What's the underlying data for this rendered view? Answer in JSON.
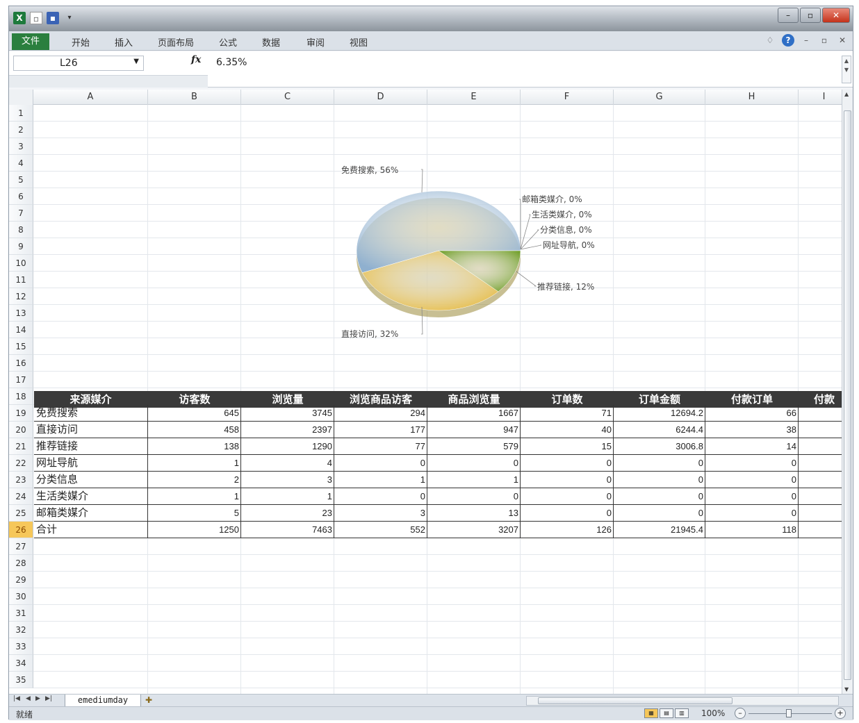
{
  "ribbon": {
    "file_tab": "文件",
    "tabs": [
      "开始",
      "插入",
      "页面布局",
      "公式",
      "数据",
      "审阅",
      "视图"
    ]
  },
  "formula_bar": {
    "name_box": "L26",
    "formula": "6.35%"
  },
  "columns": [
    "A",
    "B",
    "C",
    "D",
    "E",
    "F",
    "G",
    "H",
    "I"
  ],
  "rows": [
    "1",
    "2",
    "3",
    "4",
    "5",
    "6",
    "7",
    "8",
    "9",
    "10",
    "11",
    "12",
    "13",
    "14",
    "15",
    "16",
    "17",
    "18",
    "19",
    "20",
    "21",
    "22",
    "23",
    "24",
    "25",
    "26",
    "27",
    "28",
    "29",
    "30",
    "31",
    "32",
    "33",
    "34",
    "35"
  ],
  "selected_row": "26",
  "chart_data": {
    "type": "pie",
    "title": "",
    "slices": [
      {
        "label": "免费搜索",
        "value": 56,
        "display": "免费搜索, 56%",
        "color": "#8fb0cf"
      },
      {
        "label": "直接访问",
        "value": 32,
        "display": "直接访问, 32%",
        "color": "#e6b93c"
      },
      {
        "label": "推荐链接",
        "value": 12,
        "display": "推荐链接, 12%",
        "color": "#6f9e28"
      },
      {
        "label": "网址导航",
        "value": 0,
        "display": "网址导航, 0%",
        "color": "#8a6bb0"
      },
      {
        "label": "分类信息",
        "value": 0,
        "display": "分类信息, 0%",
        "color": "#4aa5b8"
      },
      {
        "label": "生活类媒介",
        "value": 0,
        "display": "生活类媒介, 0%",
        "color": "#e08a3a"
      },
      {
        "label": "邮箱类媒介",
        "value": 0,
        "display": "邮箱类媒介, 0%",
        "color": "#b04040"
      }
    ]
  },
  "table": {
    "headers": [
      "来源媒介",
      "访客数",
      "浏览量",
      "浏览商品访客",
      "商品浏览量",
      "订单数",
      "订单金额",
      "付款订单",
      "付款"
    ],
    "rows": [
      [
        "免费搜索",
        "645",
        "3745",
        "294",
        "1667",
        "71",
        "12694.2",
        "66",
        ""
      ],
      [
        "直接访问",
        "458",
        "2397",
        "177",
        "947",
        "40",
        "6244.4",
        "38",
        ""
      ],
      [
        "推荐链接",
        "138",
        "1290",
        "77",
        "579",
        "15",
        "3006.8",
        "14",
        ""
      ],
      [
        "网址导航",
        "1",
        "4",
        "0",
        "0",
        "0",
        "0",
        "0",
        ""
      ],
      [
        "分类信息",
        "2",
        "3",
        "1",
        "1",
        "0",
        "0",
        "0",
        ""
      ],
      [
        "生活类媒介",
        "1",
        "1",
        "0",
        "0",
        "0",
        "0",
        "0",
        ""
      ],
      [
        "邮箱类媒介",
        "5",
        "23",
        "3",
        "13",
        "0",
        "0",
        "0",
        ""
      ],
      [
        "合计",
        "1250",
        "7463",
        "552",
        "3207",
        "126",
        "21945.4",
        "118",
        ""
      ]
    ]
  },
  "sheet_tab": "emediumday",
  "status": {
    "text": "就绪",
    "zoom": "100%"
  }
}
